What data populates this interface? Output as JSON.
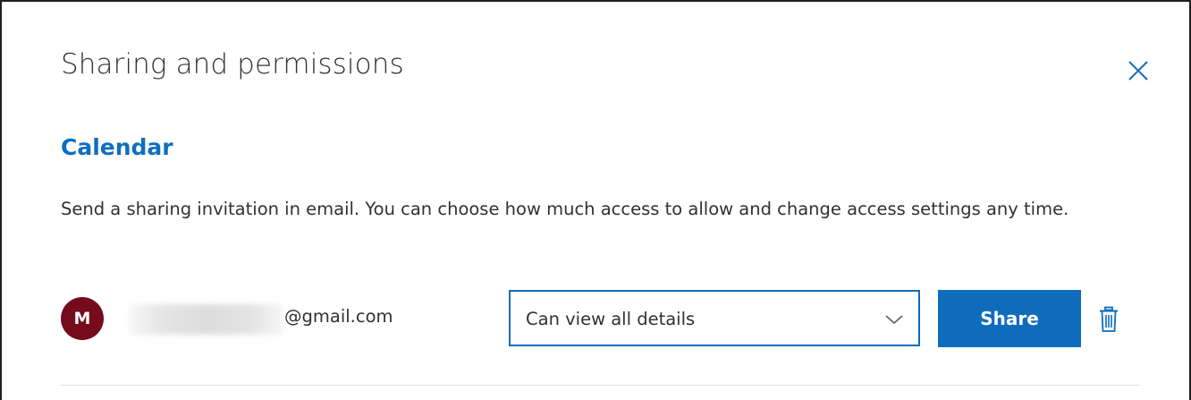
{
  "dialog": {
    "title": "Sharing and permissions",
    "close_icon": "close-icon"
  },
  "section": {
    "title": "Calendar",
    "description": "Send a sharing invitation in email. You can choose how much access to allow and change access settings any time."
  },
  "invite": {
    "avatar_initial": "M",
    "avatar_color": "#750b1c",
    "email_domain": "@gmail.com",
    "permission_selected": "Can view all details",
    "share_label": "Share",
    "delete_icon": "trash-icon"
  },
  "colors": {
    "accent": "#0f6cbd",
    "heading_blue": "#106ebe",
    "text": "#323130"
  }
}
